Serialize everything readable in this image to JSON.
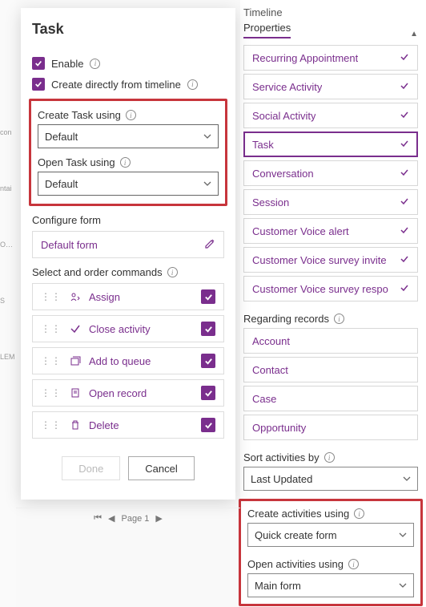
{
  "left_fragments": [
    "con",
    "ntai",
    "ORTI",
    "S",
    "LEM"
  ],
  "panel": {
    "title": "Task",
    "enable_label": "Enable",
    "create_from_timeline_label": "Create directly from timeline",
    "create_using_label": "Create Task using",
    "create_using_value": "Default",
    "open_using_label": "Open Task using",
    "open_using_value": "Default",
    "configure_form_label": "Configure form",
    "configure_form_value": "Default form",
    "commands_label": "Select and order commands",
    "commands": [
      {
        "label": "Assign",
        "icon": "person"
      },
      {
        "label": "Close activity",
        "icon": "check"
      },
      {
        "label": "Add to queue",
        "icon": "queue"
      },
      {
        "label": "Open record",
        "icon": "record"
      },
      {
        "label": "Delete",
        "icon": "trash"
      }
    ],
    "done_label": "Done",
    "cancel_label": "Cancel",
    "pager_label": "Page 1"
  },
  "right": {
    "timeline_label": "Timeline",
    "properties_tab": "Properties",
    "activity_types": [
      {
        "label": "Recurring Appointment",
        "selected": false
      },
      {
        "label": "Service Activity",
        "selected": false
      },
      {
        "label": "Social Activity",
        "selected": false
      },
      {
        "label": "Task",
        "selected": true
      },
      {
        "label": "Conversation",
        "selected": false
      },
      {
        "label": "Session",
        "selected": false
      },
      {
        "label": "Customer Voice alert",
        "selected": false
      },
      {
        "label": "Customer Voice survey invite",
        "selected": false
      },
      {
        "label": "Customer Voice survey respo",
        "selected": false
      }
    ],
    "regarding_label": "Regarding records",
    "regarding": [
      "Account",
      "Contact",
      "Case",
      "Opportunity"
    ],
    "sort_label": "Sort activities by",
    "sort_value": "Last Updated",
    "create_activities_label": "Create activities using",
    "create_activities_value": "Quick create form",
    "open_activities_label": "Open activities using",
    "open_activities_value": "Main form"
  }
}
